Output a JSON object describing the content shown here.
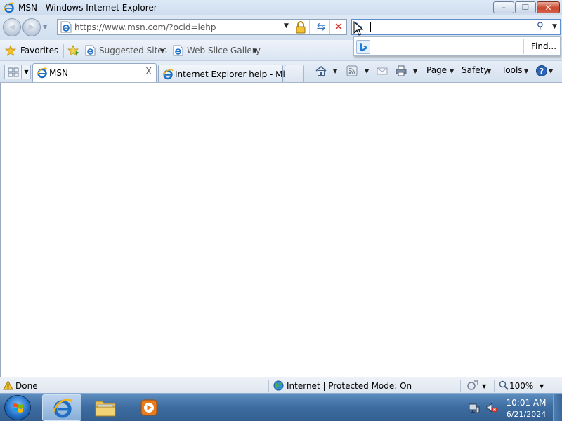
{
  "window": {
    "title": "MSN - Windows Internet Explorer",
    "controls": {
      "minimize": "–",
      "maximize": "❐",
      "close": "✕"
    }
  },
  "nav": {
    "back_glyph": "◀",
    "forward_glyph": "▶",
    "address_url": "https://www.msn.com/?ocid=iehp",
    "refresh_glyph": "⇆",
    "stop_glyph": "✕"
  },
  "search": {
    "value": "",
    "provider_icon": "bing-icon",
    "popup_find_label": "Find..."
  },
  "favorites_bar": {
    "favorites_label": "Favorites",
    "items": [
      {
        "label": "Suggested Sites",
        "icon": "ie-page-icon"
      },
      {
        "label": "Web Slice Gallery",
        "icon": "ie-page-icon"
      }
    ]
  },
  "tabs": [
    {
      "label": "MSN",
      "close": "X",
      "active": true
    },
    {
      "label": "Internet Explorer help - Mi...",
      "active": false
    }
  ],
  "command_bar": {
    "page_label": "Page",
    "safety_label": "Safety",
    "tools_label": "Tools"
  },
  "status_bar": {
    "status_text": "Done",
    "zone_text": "Internet | Protected Mode: On",
    "zoom_text": "100%"
  },
  "taskbar": {
    "pinned": [
      "internet-explorer",
      "windows-explorer",
      "windows-media-player"
    ],
    "clock_time": "10:01 AM",
    "clock_date": "6/21/2024"
  },
  "colors": {
    "titlebar": "#d6e3f2",
    "taskbar": "#3e6ea3",
    "close_button": "#c9462c",
    "ie_blue": "#1d6fc4"
  }
}
